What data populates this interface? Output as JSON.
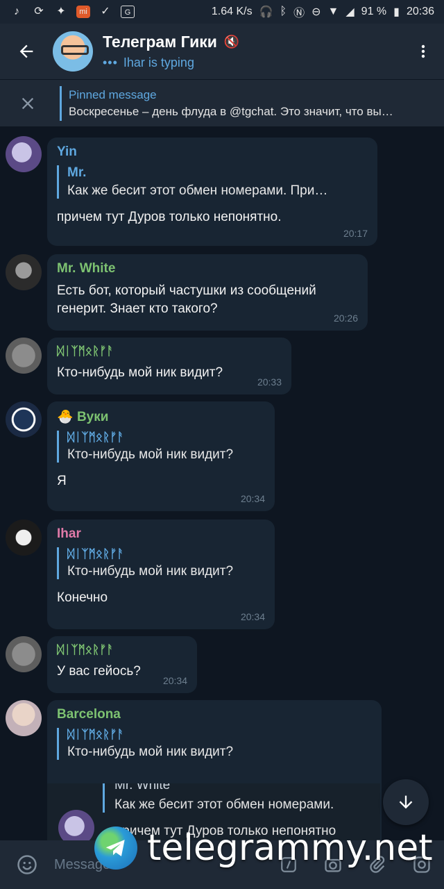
{
  "status_bar": {
    "speed": "1.64 K/s",
    "battery": "91 %",
    "time": "20:36"
  },
  "header": {
    "title": "Телеграм Гики",
    "typing": "Ihar is typing"
  },
  "pinned": {
    "title": "Pinned message",
    "text": "Воскресенье – день флуда в @tgchat.  Это значит, что вы…"
  },
  "messages": [
    {
      "sender": "Yin",
      "sender_color": "#5fa8e0",
      "reply_name": "Mr.",
      "reply_text": "Как же бесит этот обмен номерами. При…",
      "text": "причем тут Дуров только непонятно.",
      "time": "20:17"
    },
    {
      "sender": "Mr. White",
      "sender_color": "#7dc271",
      "text_line1": "Есть бот, который частушки из сообщений",
      "text_line2": "генерит. Знает кто такого?",
      "time": "20:26"
    },
    {
      "sender": "ᛞᛁᛉᛗᛟᚱᚠᚨ",
      "sender_color": "#7dc271",
      "text": "Кто-нибудь мой ник видит?",
      "time": "20:33"
    },
    {
      "sender": "Вуки",
      "sender_emoji": "🐣",
      "sender_color": "#7dc271",
      "reply_name": "ᛞᛁᛉᛗᛟᚱᚠᚨ",
      "reply_text": "Кто-нибудь мой ник видит?",
      "text": "Я",
      "time": "20:34"
    },
    {
      "sender": "Ihar",
      "sender_color": "#e07aa8",
      "reply_name": "ᛞᛁᛉᛗᛟᚱᚠᚨ",
      "reply_text": "Кто-нибудь мой ник видит?",
      "text": "Конечно",
      "time": "20:34"
    },
    {
      "sender": "ᛞᛁᛉᛗᛟᚱᚠᚨ",
      "sender_color": "#7dc271",
      "text": "У вас гейось?",
      "time": "20:34"
    },
    {
      "sender": "Barcelona",
      "sender_color": "#7dc271",
      "reply_name": "ᛞᛁᛉᛗᛟᚱᚠᚨ",
      "reply_text": "Кто-нибудь мой ник видит?"
    }
  ],
  "forwarded": {
    "name": "Mr. White",
    "line1": "Как же бесит этот обмен номерами.",
    "line2": "причем тут Дуров только непонятно"
  },
  "input": {
    "placeholder": "Message"
  },
  "watermark": "telegrammy.net",
  "icons": {
    "back": "arrow-left-icon",
    "mute": "mute-icon",
    "menu": "more-vertical-icon",
    "close": "close-icon",
    "scroll_down": "arrow-down-icon",
    "emoji": "emoji-icon",
    "command": "slash-command-icon",
    "camera": "camera-icon",
    "attach": "paperclip-icon",
    "instagram": "instagram-icon"
  }
}
